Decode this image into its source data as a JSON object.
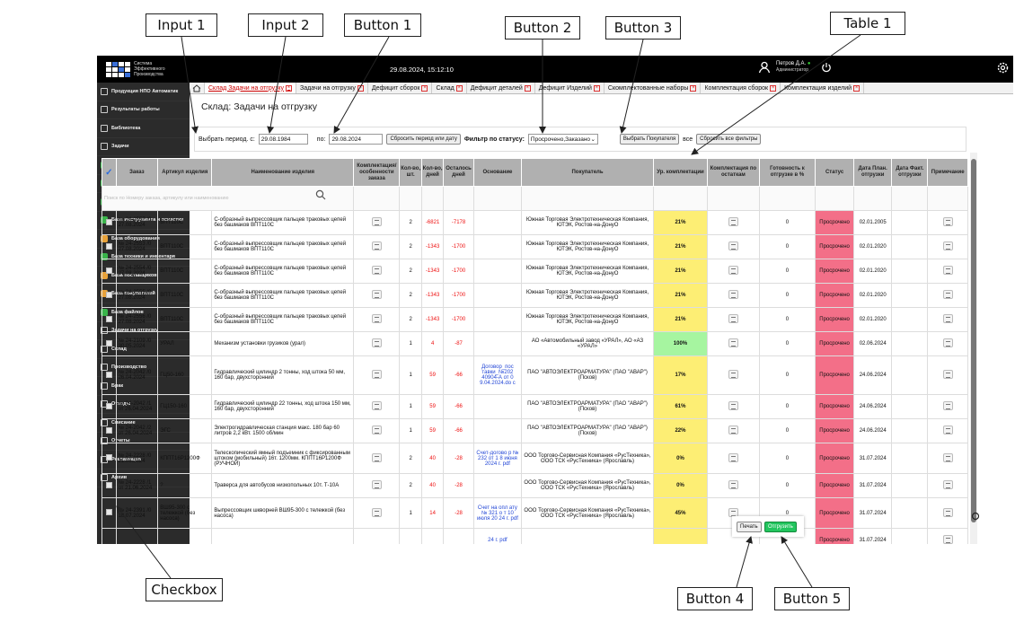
{
  "annotations": {
    "input1": "Input 1",
    "input2": "Input 2",
    "button1": "Button 1",
    "button2": "Button 2",
    "button3": "Button 3",
    "table1": "Table 1",
    "checkbox": "Checkbox",
    "button4": "Button 4",
    "button5": "Button 5"
  },
  "topbar": {
    "logo_line1": "Система",
    "logo_line2": "Эффективного",
    "logo_line3": "Производства",
    "datetime": "29.08.2024, 15:12:10",
    "user_name": "Петров Д.А.",
    "user_role": "Администратор"
  },
  "sidebar": {
    "items": [
      {
        "label": "Продукция НПО Автоматик",
        "icon": "factory-icon"
      },
      {
        "label": "Результаты работы",
        "icon": "tools-icon"
      },
      {
        "label": "Библиотека",
        "icon": "library-icon"
      },
      {
        "label": "Задачи",
        "icon": "tasks-icon"
      },
      {
        "label": "База сборочных единиц",
        "icon": "db-icon"
      },
      {
        "label": "База деталей",
        "icon": "db-icon"
      },
      {
        "label": "База материалов",
        "icon": "db-icon"
      },
      {
        "label": "База инструмента и оснастки",
        "icon": "db-icon"
      },
      {
        "label": "База оборудования",
        "icon": "db-icon"
      },
      {
        "label": "База техники и инвентаря",
        "icon": "db-icon"
      },
      {
        "label": "База поставщиков",
        "icon": "db-icon"
      },
      {
        "label": "База покупателей",
        "icon": "db-icon"
      },
      {
        "label": "База файлов",
        "icon": "db-icon"
      },
      {
        "label": "Задачи на отгрузку",
        "icon": "calendar-icon"
      },
      {
        "label": "Склад",
        "icon": "warehouse-icon"
      },
      {
        "label": "Производство",
        "icon": "production-icon"
      },
      {
        "label": "Брак",
        "icon": "defect-icon"
      },
      {
        "label": "Отходы",
        "icon": "recycle-icon"
      },
      {
        "label": "Списание",
        "icon": "minus-icon"
      },
      {
        "label": "Отчеты",
        "icon": "report-icon"
      },
      {
        "label": "Рекламация",
        "icon": "claim-icon"
      },
      {
        "label": "Архив",
        "icon": "archive-icon"
      }
    ]
  },
  "tabs": [
    "Склад Задачи на отгрузку",
    "Задачи на отгрузку",
    "Дефицит сборок",
    "Склад",
    "Дефицит деталей",
    "Дефицит Изделий",
    "Скомплектованные наборы",
    "Комплектация сборок",
    "Комплектация изделий"
  ],
  "page": {
    "title": "Склад: Задачи на отгрузку"
  },
  "filters": {
    "period_label": "Выбрать период. с:",
    "date_from": "29.08.1984",
    "to_label": "по:",
    "date_to": "29.08.2024",
    "reset_period_btn": "Сбросить период или дату",
    "status_label": "Фильтр по статусу:",
    "status_value": "Просрочено,Заказано",
    "choose_buyer_btn": "Выбрать Покупателя",
    "all_label": "все",
    "reset_all_btn": "Сбросить все фильтры"
  },
  "table": {
    "headers": [
      "",
      "Заказ",
      "Артикул изделия",
      "Наименование изделия",
      "Комплектация/особенности заказа",
      "Кол-во, шт.",
      "Кол-во, дней",
      "Осталось дней",
      "Основание",
      "Покупатель",
      "Ур. комплектации",
      "Комплектация по остаткам",
      "Готовность к отгрузке в %",
      "Статус",
      "Дата План. отгрузки",
      "Дата Факт. отгрузки",
      "Примечание"
    ],
    "search_placeholder": "Поиск по Номеру заказа, артикулу или наименованию",
    "rows": [
      {
        "order": "№ 24-2557 /0 27.08.2024",
        "art": "ВПТ110С",
        "name": "С-образный выпрессовщик пальцев траковых цепей без башмаков ВПТ110С",
        "qty": "2",
        "days": "-6821",
        "left": "-7178",
        "basis": "",
        "buyer": "Южная Торговая Электротехническая Компания, ЮТЭК, Ростов-на-ДонуО",
        "level": "21%",
        "lvl": "y",
        "ready": "0",
        "status": "Просрочено",
        "plan": "02.01.2005"
      },
      {
        "order": "№ 24-2553 /0 27.08.2024",
        "art": "ВПТ110С",
        "name": "С-образный выпрессовщик пальцев траковых цепей без башмаков ВПТ110С",
        "qty": "2",
        "days": "-1343",
        "left": "-1700",
        "basis": "",
        "buyer": "Южная Торговая Электротехническая Компания, ЮТЭК, Ростов-на-ДонуО",
        "level": "21%",
        "lvl": "y",
        "ready": "0",
        "status": "Просрочено",
        "plan": "02.01.2020"
      },
      {
        "order": "№ 24-2554 /0 27.08.2024",
        "art": "ВПТ110С",
        "name": "С-образный выпрессовщик пальцев траковых цепей без башмаков ВПТ110С",
        "qty": "2",
        "days": "-1343",
        "left": "-1700",
        "basis": "",
        "buyer": "Южная Торговая Электротехническая Компания, ЮТЭК, Ростов-на-ДонуО",
        "level": "21%",
        "lvl": "y",
        "ready": "0",
        "status": "Просрочено",
        "plan": "02.01.2020"
      },
      {
        "order": "№ 24-2555 /0 27.08.2024",
        "art": "ВПТ110С",
        "name": "С-образный выпрессовщик пальцев траковых цепей без башмаков ВПТ110С",
        "qty": "2",
        "days": "-1343",
        "left": "-1700",
        "basis": "",
        "buyer": "Южная Торговая Электротехническая Компания, ЮТЭК, Ростов-на-ДонуО",
        "level": "21%",
        "lvl": "y",
        "ready": "0",
        "status": "Просрочено",
        "plan": "02.01.2020"
      },
      {
        "order": "№ 24-2556 /0 27.08.2024",
        "art": "ВПТ110С",
        "name": "С-образный выпрессовщик пальцев траковых цепей без башмаков ВПТ110С",
        "qty": "2",
        "days": "-1343",
        "left": "-1700",
        "basis": "",
        "buyer": "Южная Торговая Электротехническая Компания, ЮТЭК, Ростов-на-ДонуО",
        "level": "21%",
        "lvl": "y",
        "ready": "0",
        "status": "Просрочено",
        "plan": "02.01.2020"
      },
      {
        "order": "№ 24-2109 /0 30.05.2024",
        "art": "УРАЛ",
        "name": "Механизм установки грузиков (урал)",
        "qty": "1",
        "days": "4",
        "left": "-87",
        "basis": "",
        "buyer": "АО «Автомобильный завод «УРАЛ», АО «АЗ «УРАЛ»",
        "level": "100%",
        "lvl": "gr",
        "ready": "0",
        "status": "Просрочено",
        "plan": "02.06.2024"
      },
      {
        "order": "№ 24-2042 /0 26.04.2024",
        "art": "ГЦ50-160",
        "name": "Гидравлический цилиндр 2 тонны, ход штока 50 мм, 160 бар, двухсторонний",
        "qty": "1",
        "days": "59",
        "left": "-66",
        "basis": "Договор_пос тавки_№202 40904-А от 0 9.04.2024.do c",
        "buyer": "ПАО \"АВТОЭЛЕКТРОАРМАТУРА\" (ПАО \"АВАР\") (Псков)",
        "level": "17%",
        "lvl": "y",
        "ready": "0",
        "status": "Просрочено",
        "plan": "24.06.2024"
      },
      {
        "order": "№ 24-2042 /1 от 26.04.2024",
        "art": "ГЦ150-160",
        "name": "Гидравлический цилиндр 22 тонны, ход штока 150 мм, 160 бар, двухсторонний",
        "qty": "1",
        "days": "59",
        "left": "-66",
        "basis": "",
        "buyer": "ПАО \"АВТОЭЛЕКТРОАРМАТУРА\" (ПАО \"АВАР\") (Псков)",
        "level": "61%",
        "lvl": "y",
        "ready": "0",
        "status": "Просрочено",
        "plan": "24.06.2024"
      },
      {
        "order": "№ 24-2042 /2 от 26.04.2024",
        "art": "ЭГС",
        "name": "Электрогидравлическая станция макс. 180 бар 60 литров 2,2 кВт. 1500 об/мин",
        "qty": "1",
        "days": "59",
        "left": "-66",
        "basis": "",
        "buyer": "ПАО \"АВТОЭЛЕКТРОАРМАТУРА\" (ПАО \"АВАР\") (Псков)",
        "level": "22%",
        "lvl": "y",
        "ready": "0",
        "status": "Просрочено",
        "plan": "24.06.2024"
      },
      {
        "order": "№ 24-2228 /0 21.06.2024",
        "art": "КППТ16Р1200Ф",
        "name": "Телескопический ямный подъемник с фиксированным штоком (мобильный) 16т. 1200мм. КППТ16Р1200Ф (РУЧНОЙ)",
        "qty": "2",
        "days": "40",
        "left": "-28",
        "basis": "Счет-догово р № 232 от 1 8 июня 2024 г. pdf",
        "buyer": "ООО Торгово-Сервисная Компания «РусТехника», ООО ТСК «РусТехника» (Ярославль)",
        "level": "0%",
        "lvl": "y",
        "ready": "0",
        "status": "Просрочено",
        "plan": "31.07.2024"
      },
      {
        "order": "№ 24-2228 /1 от 21.06.2024",
        "art": "?",
        "name": "Траверса для автобусов низкопольных 10т. Т-10А",
        "qty": "2",
        "days": "40",
        "left": "-28",
        "basis": "",
        "buyer": "ООО Торгово-Сервисная Компания «РусТехника», ООО ТСК «РусТехника» (Ярославль)",
        "level": "0%",
        "lvl": "y",
        "ready": "0",
        "status": "Просрочено",
        "plan": "31.07.2024"
      },
      {
        "order": "№ 24-2391 /0 18.07.2024",
        "art": "ВШ95-300 с тележкой (без насоса)",
        "name": "Выпрессовщик шкворней ВШ95-300 с тележкой (без насоса)",
        "qty": "1",
        "days": "14",
        "left": "-28",
        "basis": "Счет на опл ату № 321 о т 10 июля 20 24 г. pdf",
        "buyer": "ООО Торгово-Сервисная Компания «РусТехника», ООО ТСК «РусТехника» (Ярославль)",
        "level": "45%",
        "lvl": "y",
        "ready": "0",
        "status": "Просрочено",
        "plan": "31.07.2024"
      },
      {
        "order": "",
        "art": "",
        "name": "",
        "qty": "",
        "days": "",
        "left": "",
        "basis": "24 г. pdf",
        "buyer": "",
        "level": "",
        "lvl": "y",
        "ready": "",
        "status": "Просрочено",
        "plan": "31.07.2024"
      }
    ]
  },
  "bottom": {
    "print_btn": "Печать",
    "ship_btn": "Отгрузить"
  }
}
